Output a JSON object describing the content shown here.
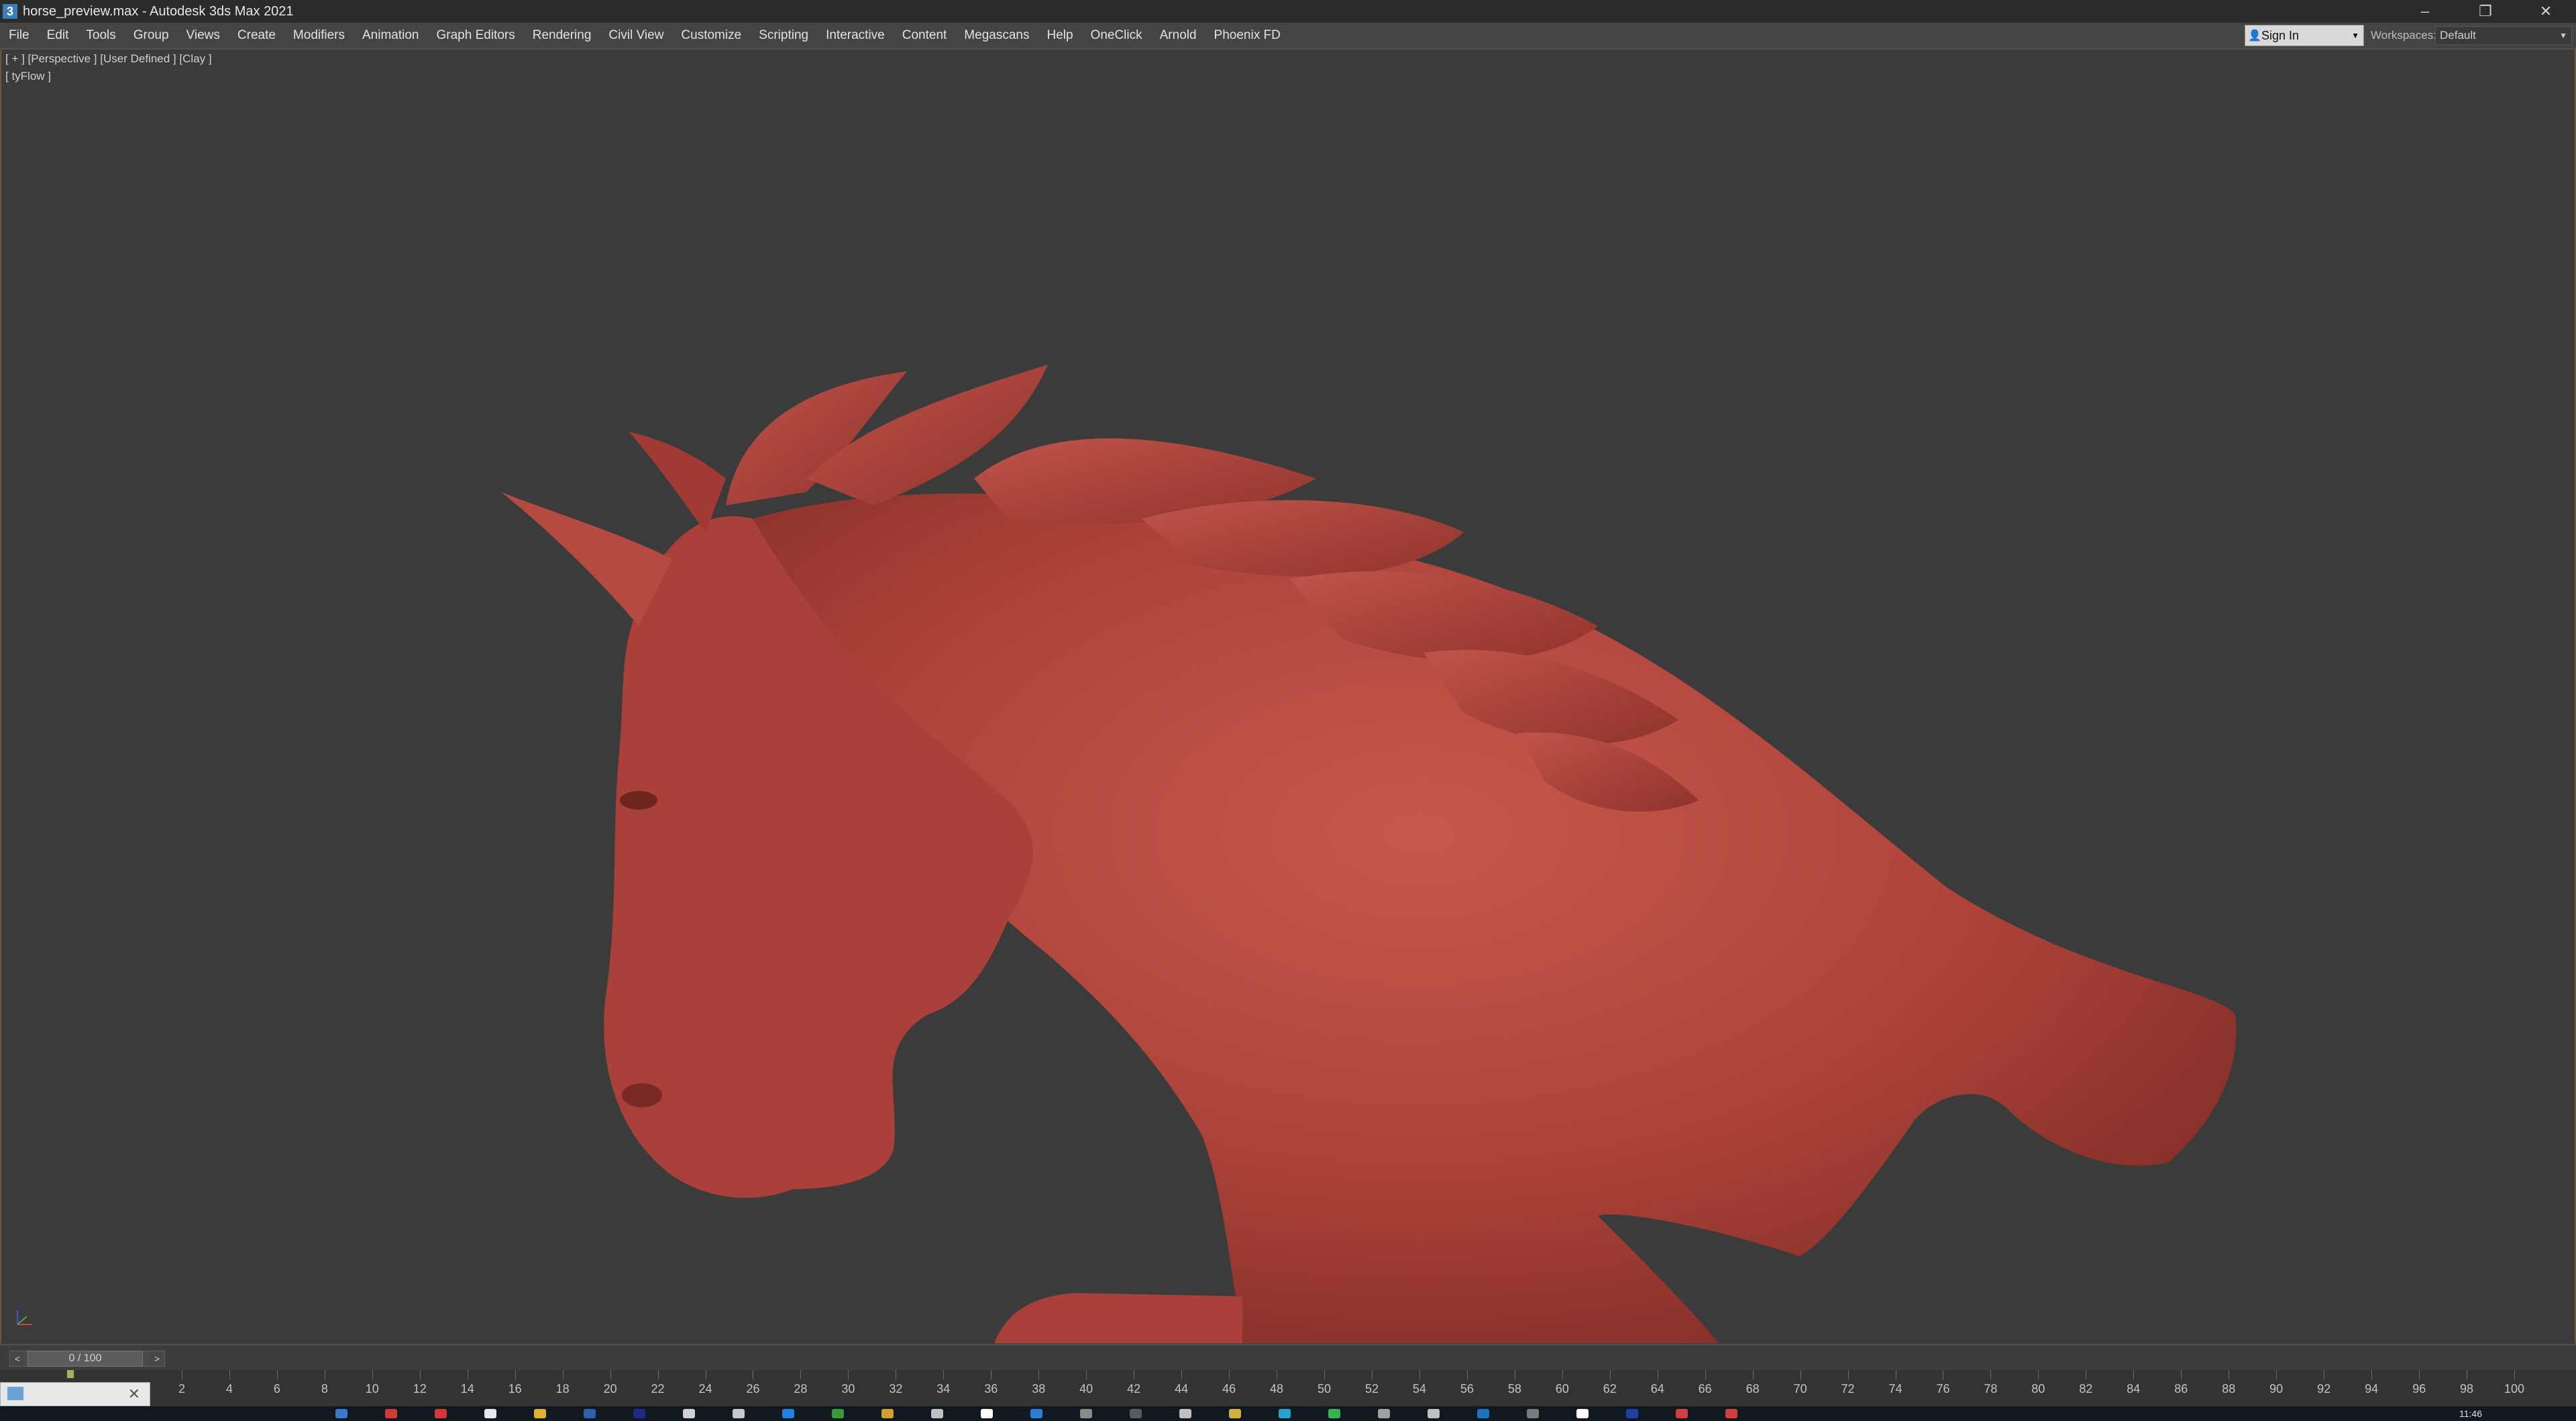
{
  "window": {
    "title": "horse_preview.max - Autodesk 3ds Max 2021",
    "app_icon_glyph": "3",
    "controls": {
      "minimize": "–",
      "restore": "❐",
      "close": "✕"
    }
  },
  "menu": {
    "items": [
      "File",
      "Edit",
      "Tools",
      "Group",
      "Views",
      "Create",
      "Modifiers",
      "Animation",
      "Graph Editors",
      "Rendering",
      "Civil View",
      "Customize",
      "Scripting",
      "Interactive",
      "Content",
      "Megascans",
      "Help",
      "OneClick",
      "Arnold",
      "Phoenix FD"
    ],
    "sign_in_label": "Sign In",
    "workspaces_label": "Workspaces:",
    "workspaces_value": "Default"
  },
  "viewport": {
    "labels_line1": "[ + ] [Perspective ] [User Defined ] [Clay ]",
    "labels_line2": "[ tyFlow ]",
    "model_color": "#b4473e",
    "background_color": "#3b3b3b"
  },
  "timeline": {
    "slider_value": "0 / 100",
    "prev_arrow": "<",
    "next_arrow": ">",
    "ticks": [
      2,
      4,
      6,
      8,
      10,
      12,
      14,
      16,
      18,
      20,
      22,
      24,
      26,
      28,
      30,
      32,
      34,
      36,
      38,
      40,
      42,
      44,
      46,
      48,
      50,
      52,
      54,
      56,
      58,
      60,
      62,
      64,
      66,
      68,
      70,
      72,
      74,
      76,
      78,
      80,
      82,
      84,
      86,
      88,
      90,
      92,
      94,
      96,
      98,
      100
    ],
    "tick_range": [
      0,
      100
    ]
  },
  "taskbar": {
    "clock": "11:46",
    "icon_colors": [
      "#3a78c8",
      "#d23a3a",
      "#d23a3a",
      "#e8e8e8",
      "#e0b030",
      "#2e5fae",
      "#1e2a8a",
      "#d0d0d0",
      "#c8c8c8",
      "#2080e0",
      "#3a9a3a",
      "#d0a030",
      "#c0c0c0",
      "#ffffff",
      "#2a7fd0",
      "#8a8a8a",
      "#5a5a5a",
      "#c0c0c0",
      "#d0b040",
      "#2aa0d0",
      "#3ab050",
      "#a0a0a0",
      "#c0c0c0",
      "#2070c0",
      "#7a7a7a",
      "#ffffff",
      "#2040a0",
      "#d04040",
      "#d04040"
    ]
  }
}
